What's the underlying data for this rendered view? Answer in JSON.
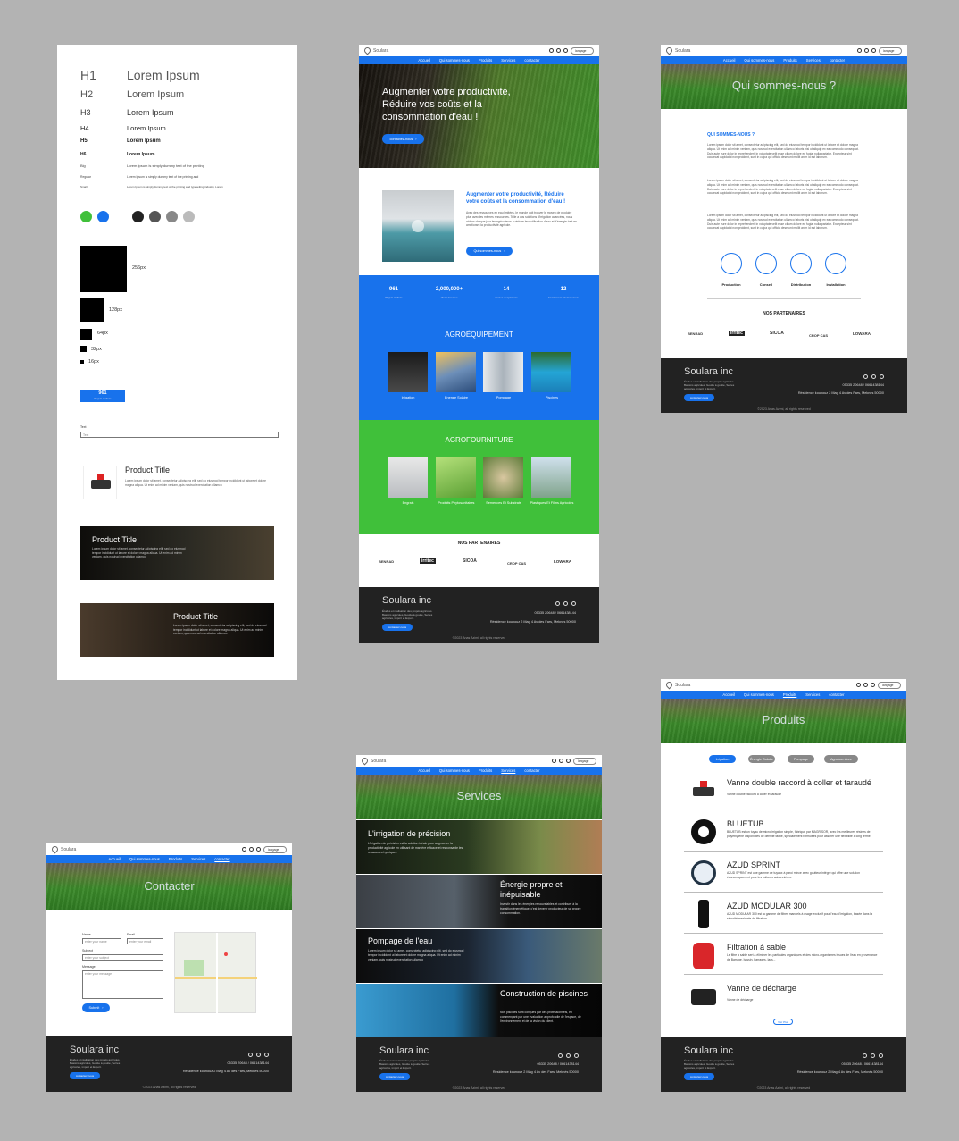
{
  "style_guide": {
    "headings": [
      {
        "tag": "H1",
        "sample": "Lorem Ipsum"
      },
      {
        "tag": "H2",
        "sample": "Lorem Ipsum"
      },
      {
        "tag": "H3",
        "sample": "Lorem Ipsum"
      },
      {
        "tag": "H4",
        "sample": "Lorem Ipsum"
      },
      {
        "tag": "H5",
        "sample": "Lorem Ipsum"
      },
      {
        "tag": "H6",
        "sample": "Lorem Ipsum"
      },
      {
        "tag": "Big",
        "sample": "Lorem Ipsum is simply dummy text of the printing"
      },
      {
        "tag": "Regular",
        "sample": "Lorem Ipsum is simply dummy text of the printing and"
      },
      {
        "tag": "Small",
        "sample": "Lorem Ipsum is simply dummy text of the printing and typesetting industry. Lorem"
      }
    ],
    "colors": [
      "#40c03a",
      "#1872ec",
      "#222222",
      "#555555",
      "#888888",
      "#bbbbbb"
    ],
    "sizes": [
      "256px",
      "128px",
      "64px",
      "32px",
      "16px"
    ],
    "stat_sample": {
      "number": "961",
      "label": "Projets réalisés"
    },
    "input_label": "Text",
    "input_value": "Text",
    "card_title": "Product Title",
    "card_text": "Lorem ipsum dolor sit amet, consectetur adipiscing elit, sed do eiusmod tempor incididunt ut labore et dolore magna aliqua. Ut enim ad minim veniam, quis nostrud exercitation ullamco"
  },
  "site": {
    "brand": "Soulara",
    "language": "langage",
    "nav": [
      "Accueil",
      "Qui sommes-nous",
      "Produits",
      "Services",
      "contacter"
    ],
    "footer": {
      "title": "Soulara inc",
      "desc": "Études et réalisation des projets agricoles. Bassins agricoles, Goutte à goutte, Serres agricoles, import et Export.",
      "phone": "05335 20648 / 0661438144",
      "address": "Résidence kounouz 2 Mag 4 Av des Fars, Meknès 50000",
      "button": "contactez-nous",
      "copyright": "©2023 Anas Azimi, all rights reserved"
    }
  },
  "home": {
    "hero_title": "Augmenter votre productivité, Réduire vos coûts et la consommation d'eau !",
    "hero_button": "contactez-nous",
    "intro_title": "Augmenter votre productivité, Réduire votre coûts et la consommation d'eau !",
    "intro_text": "Avec des ressources en eau limitées, le monde doit trouver le moyen de produire plus avec les mêmes ressources. Telle a vos solutions d'irrigation avancées, nous aidons chaque jour les agriculteurs à réduire leur utilisation d'eau et d'énergie tout en améliorant la productivité agricole.",
    "intro_button": "Qui sommes-nous",
    "stats": [
      {
        "num": "961",
        "label": "Projets réalisés"
      },
      {
        "num": "2,000,000+",
        "label": "clients heureux"
      },
      {
        "num": "14",
        "label": "années d'expérience"
      },
      {
        "num": "12",
        "label": "fournisseurs internationaux"
      }
    ],
    "equip_title": "AGROÉQUIPEMENT",
    "equip": [
      "Irrigation",
      "Énergie Solaire",
      "Pompage",
      "Piscines"
    ],
    "fourn_title": "AGROFOURNITURE",
    "fourn": [
      "Engrais",
      "Produits Phytosanitaires",
      "Semences Et Substrats",
      "Plastiques Et Films Agricoles"
    ],
    "partners_title": "NOS PARTENAIRES",
    "partners": [
      "BENRAD",
      "irritec",
      "SICOA",
      "CROP CAS",
      "LOWARA"
    ]
  },
  "about": {
    "hero_title": "Qui sommes-nous ?",
    "section_title": "QUI SOMMES-NOUS ?",
    "paragraph": "Lorem ipsum dolor sit amet, consectetur adipiscing elit, sed do eiusmod tempor incididunt ut labore et dolore magna aliqua. Ut enim ad minim veniam, quis nostrud exercitation ullamco laboris nisi ut aliquip ex ea commodo consequat. Duis aute irure dolor in reprehenderit in voluptate velit esse cillum dolore eu fugiat nulla pariatur. Excepteur sint occaecat cupidatat non proident, sunt in culpa qui officia deserunt mollit anim id est laborum.",
    "icons": [
      "Production",
      "Conseil",
      "Distribution",
      "Installation"
    ],
    "partners_title": "NOS PARTENAIRES"
  },
  "contact": {
    "hero_title": "Contacter",
    "name_label": "Name",
    "name_ph": "enter your name",
    "email_label": "Email",
    "email_ph": "enter your email",
    "subject_label": "Subject",
    "subject_ph": "enter your subject",
    "message_label": "Message",
    "message_ph": "enter your message",
    "submit": "Submit"
  },
  "services": {
    "hero_title": "Services",
    "items": [
      {
        "title": "L'irrigation de précision",
        "text": "L'irrigation de précision est la solution idéale pour augmenter la productivité agricole en utilisant de manière efficace et responsable les ressources hydriques."
      },
      {
        "title": "Énergie propre et inépuisable",
        "text": "Investir dans les énergies renouvelables et contribuer à la transition énergétique, c'est devenir producteur de sa propre consommation."
      },
      {
        "title": "Pompage de l'eau",
        "text": "Lorem ipsum dolor sit amet, consectetur adipiscing elit, sed do eiusmod tempor incididunt ut labore et dolore magna aliqua. Ut enim ad minim veniam, quis nostrud exercitation ullamco"
      },
      {
        "title": "Construction de piscines",
        "text": "Nos piscines sont conçues par des professionnels, en commençant par une évaluation approfondie de l'espace, de l'environnement et de la vision du client."
      }
    ]
  },
  "products": {
    "hero_title": "Produits",
    "tabs": [
      "Irrigation",
      "Énergie Solaire",
      "Pompage",
      "Agrofourniture"
    ],
    "items": [
      {
        "name": "Vanne double raccord à coller et taraudé",
        "desc": "Vanne double raccord à coller et taraudé"
      },
      {
        "name": "BLUETUB",
        "desc": "BLUETUB est un tuyau de micro-irrigation simple, fabriqué par MAGRISOR, avec les meilleures résines de polyéthylène disponibles de densité faible, spécialement formulées pour assurer une flexibilité à long terme."
      },
      {
        "name": "AZUD SPRINT",
        "desc": "AZUD SPRINT est une gamme de tuyaux à paroi mince avec goutteur intégré qui offre une solution économiquement pour les cultures saisonnières."
      },
      {
        "name": "AZUD MODULAR 300",
        "desc": "AZUD MODULAR 300 est la gamme de filtres manuels à usage exclusif pour l'eau d'irrigation, basée dans la sécurité maximale de filtration."
      },
      {
        "name": "Filtration à sable",
        "desc": "Le filtre à sable sert à éliminer les particules organiques et des micro-organismes issues de l'eau en provenance de Barrage, bassin, barrages, lacs..."
      },
      {
        "name": "Vanne de décharge",
        "desc": "Vanne de décharge"
      }
    ],
    "more": "Voir Plus"
  }
}
